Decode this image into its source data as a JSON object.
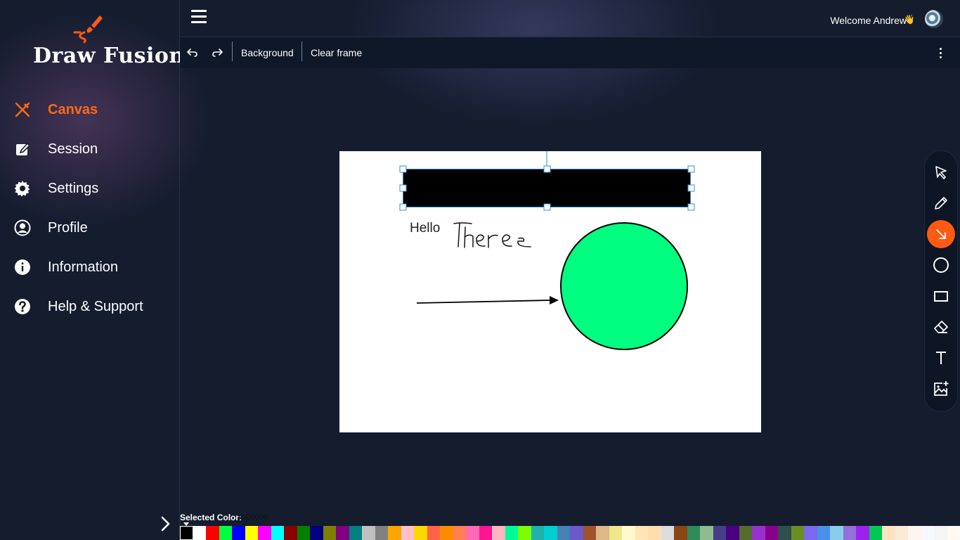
{
  "app": {
    "name": "Draw Fusion"
  },
  "sidebar": {
    "items": [
      {
        "label": "Canvas",
        "icon": "paintbrush-pencil-icon",
        "active": true
      },
      {
        "label": "Session",
        "icon": "edit-square-icon",
        "active": false
      },
      {
        "label": "Settings",
        "icon": "gear-icon",
        "active": false
      },
      {
        "label": "Profile",
        "icon": "user-circle-icon",
        "active": false
      },
      {
        "label": "Information",
        "icon": "info-icon",
        "active": false
      },
      {
        "label": "Help & Support",
        "icon": "question-icon",
        "active": false
      }
    ],
    "expand_icon": "chevron-right-icon"
  },
  "header": {
    "welcome": "Welcome Andrew",
    "wave_emoji": "👋",
    "menu_icon": "hamburger-icon"
  },
  "toolbar": {
    "undo_icon": "undo-icon",
    "redo_icon": "redo-icon",
    "background_label": "Background",
    "clear_label": "Clear frame",
    "more_icon": "kebab-menu-icon"
  },
  "canvas": {
    "hello_text": "Hello",
    "handwriting_text": "There",
    "circle_fill": "#00ff80",
    "rect_fill": "#000000"
  },
  "tools": [
    {
      "name": "select",
      "icon": "cursor-icon",
      "active": false
    },
    {
      "name": "pencil",
      "icon": "pencil-icon",
      "active": false
    },
    {
      "name": "arrow",
      "icon": "arrow-icon",
      "active": true
    },
    {
      "name": "circle",
      "icon": "circle-icon",
      "active": false
    },
    {
      "name": "rectangle",
      "icon": "rectangle-icon",
      "active": false
    },
    {
      "name": "eraser",
      "icon": "eraser-icon",
      "active": false
    },
    {
      "name": "text",
      "icon": "text-icon",
      "active": false
    },
    {
      "name": "image",
      "icon": "add-image-icon",
      "active": false
    }
  ],
  "colors": {
    "accent": "#ff6a13",
    "selected_label": "Selected Color:",
    "selected_value": "#000000",
    "palette": [
      "#000000",
      "#ffffff",
      "#ff0000",
      "#00ff40",
      "#0000ff",
      "#ffff00",
      "#ff00ff",
      "#00ffff",
      "#8b0000",
      "#008000",
      "#000080",
      "#808000",
      "#800080",
      "#008080",
      "#c0c0c0",
      "#808080",
      "#ffa500",
      "#ffc0cb",
      "#ffd700",
      "#ff6347",
      "#ff8c00",
      "#ff7f50",
      "#ff69b4",
      "#ff1493",
      "#ffb6c1",
      "#00fa9a",
      "#7cfc00",
      "#20b2aa",
      "#00ced1",
      "#4682b4",
      "#6a5acd",
      "#a0522d",
      "#deb887",
      "#f0e68c",
      "#fffacd",
      "#ffe4b5",
      "#ffdead",
      "#dcdcdc",
      "#8b4513",
      "#2e8b57",
      "#8fbc8f",
      "#483d8b",
      "#4b0082",
      "#556b2f",
      "#9932cc",
      "#8b008b",
      "#2f4f4f",
      "#6b8e23",
      "#7b68ee",
      "#4a8fe8",
      "#87ceeb",
      "#9370db",
      "#a020f0",
      "#00c853",
      "#ffe4c4",
      "#faebd7",
      "#fff5ee",
      "#f8f8ff",
      "#f5f5f5",
      "#fffaf0"
    ]
  }
}
